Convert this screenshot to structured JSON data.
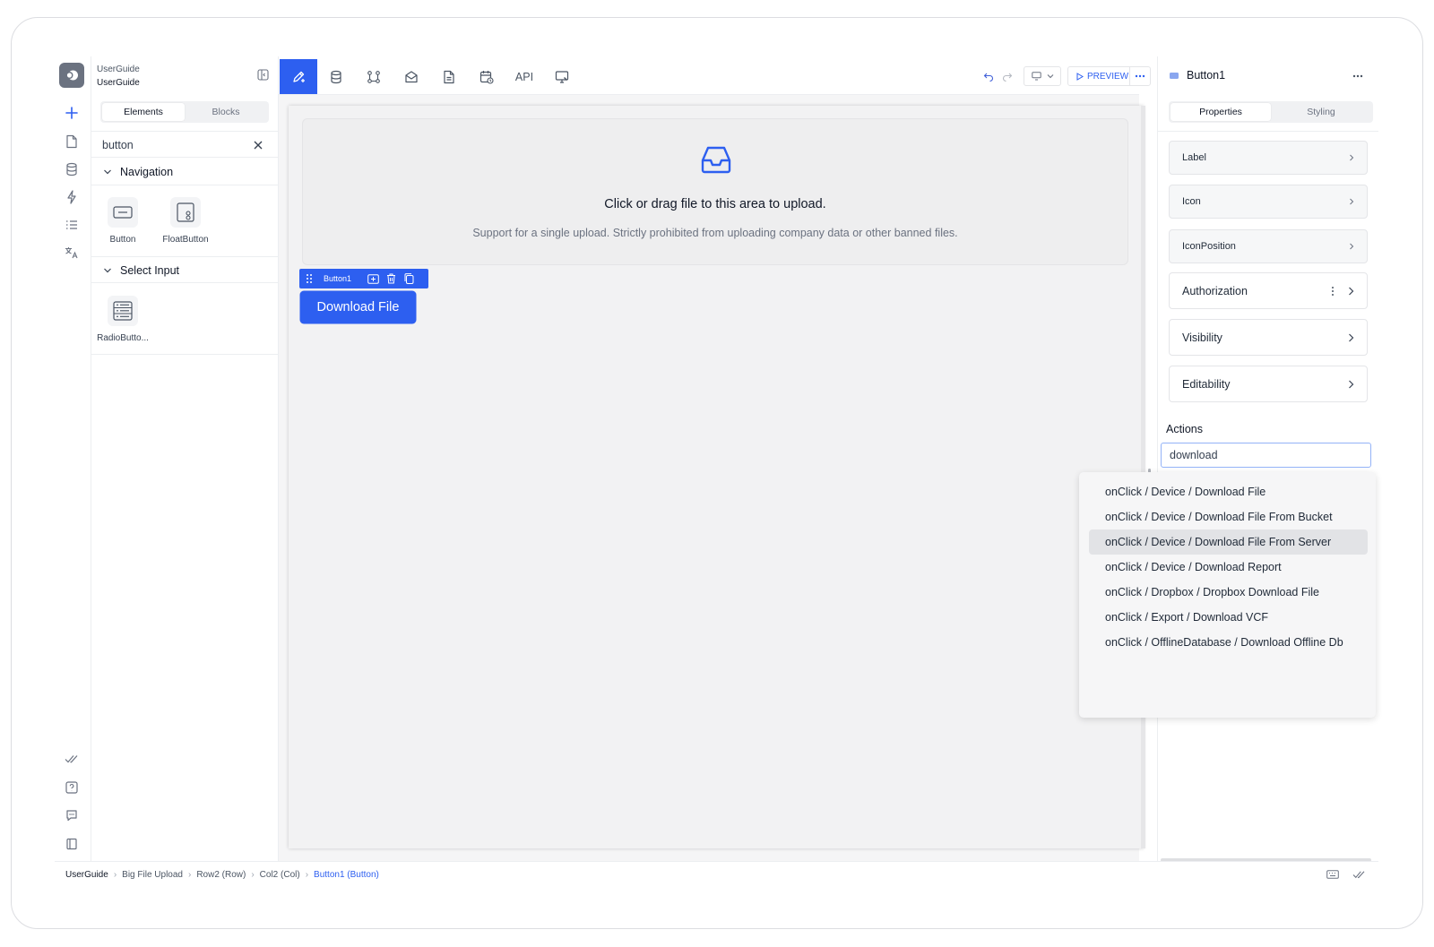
{
  "project": {
    "line1": "UserGuide",
    "line2": "UserGuide"
  },
  "left_panel": {
    "tabs": [
      "Elements",
      "Blocks"
    ],
    "active_tab": "Elements",
    "search_value": "button",
    "sections": [
      {
        "title": "Navigation",
        "items": [
          "Button",
          "FloatButton"
        ]
      },
      {
        "title": "Select Input",
        "items": [
          "RadioButto..."
        ]
      }
    ]
  },
  "toolbar": {
    "api_label": "API",
    "preview_label": "PREVIEW"
  },
  "canvas": {
    "upload_title": "Click or drag file to this area to upload.",
    "upload_hint": "Support for a single upload. Strictly prohibited from uploading company data or other banned files.",
    "selected_name": "Button1",
    "button_label": "Download File"
  },
  "right_panel": {
    "component_name": "Button1",
    "tabs": [
      "Properties",
      "Styling"
    ],
    "active_tab": "Properties",
    "small_props": [
      "Label",
      "Icon",
      "IconPosition"
    ],
    "large_props": [
      "Authorization",
      "Visibility",
      "Editability"
    ],
    "actions_label": "Actions",
    "actions_search": "download",
    "action_options": [
      "onClick / Device / Download File",
      "onClick / Device / Download File From Bucket",
      "onClick / Device / Download File From Server",
      "onClick / Device / Download Report",
      "onClick / Dropbox / Dropbox Download File",
      "onClick / Export / Download VCF",
      "onClick / OfflineDatabase / Download Offline Db"
    ],
    "highlighted_option": 2
  },
  "breadcrumb": [
    "UserGuide",
    "Big File Upload",
    "Row2 (Row)",
    "Col2 (Col)",
    "Button1 (Button)"
  ],
  "colors": {
    "accent": "#2d5ff0",
    "panel_border": "#eceef1",
    "canvas": "#f2f2f3"
  }
}
